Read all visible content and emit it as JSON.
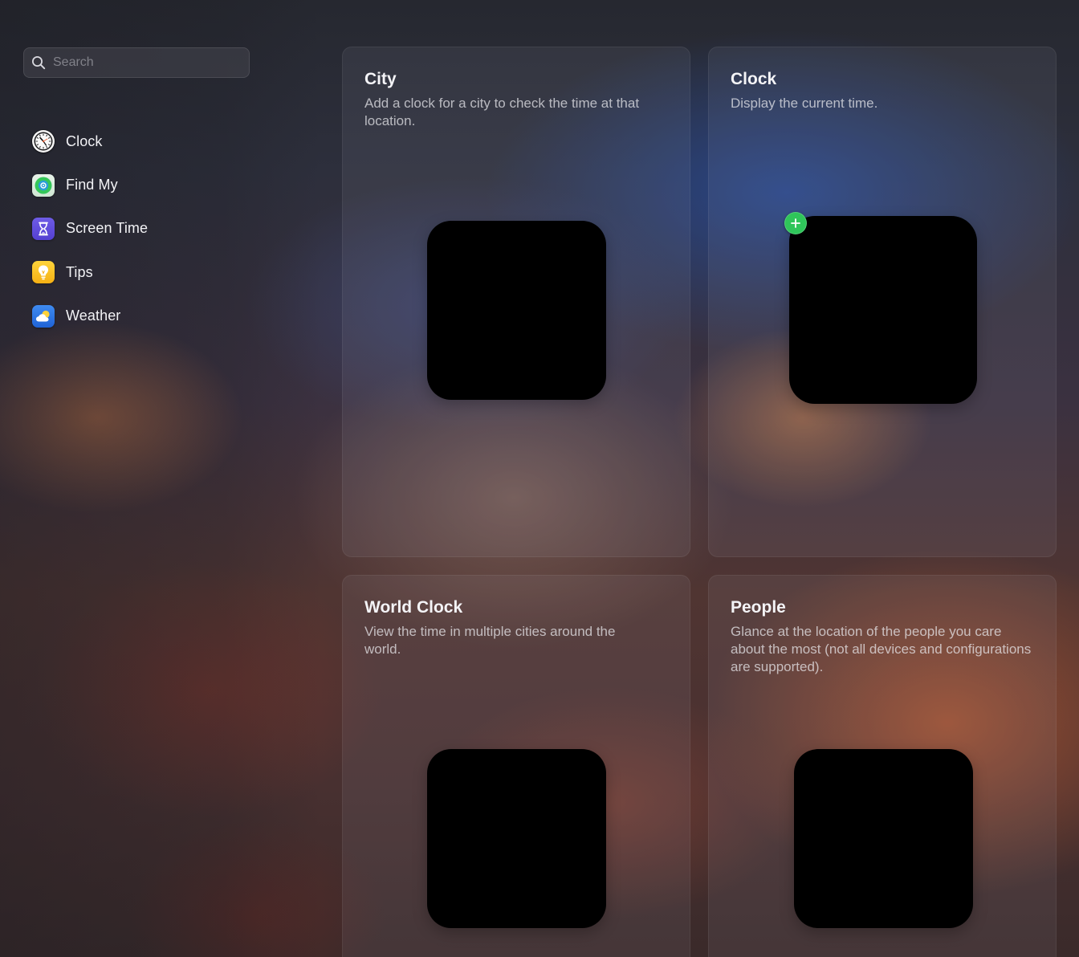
{
  "search": {
    "placeholder": "Search",
    "value": ""
  },
  "sidebar": {
    "items": [
      {
        "label": "Clock",
        "icon": "clock-app-icon"
      },
      {
        "label": "Find My",
        "icon": "find-my-app-icon"
      },
      {
        "label": "Screen Time",
        "icon": "screen-time-app-icon"
      },
      {
        "label": "Tips",
        "icon": "tips-app-icon"
      },
      {
        "label": "Weather",
        "icon": "weather-app-icon"
      }
    ]
  },
  "widgets": [
    {
      "title": "City",
      "description": "Add a clock for a city to check the time at that location."
    },
    {
      "title": "Clock",
      "description": "Display the current time.",
      "add_badge": "plus-icon"
    },
    {
      "title": "World Clock",
      "description": "View the time in multiple cities around the world."
    },
    {
      "title": "People",
      "description": "Glance at the location of the people you care about the most (not all devices and configurations are supported)."
    }
  ],
  "colors": {
    "add_badge": "#2fc55a",
    "preview_fill": "#000000"
  }
}
